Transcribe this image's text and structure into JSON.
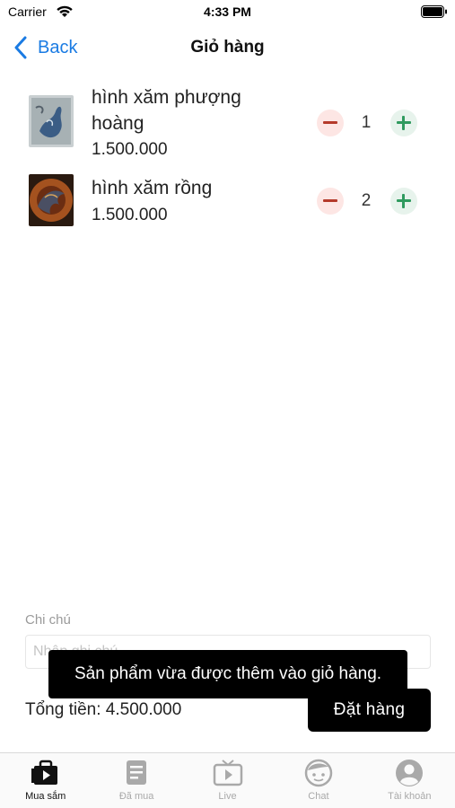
{
  "status_bar": {
    "carrier": "Carrier",
    "time": "4:33 PM"
  },
  "nav": {
    "back_label": "Back",
    "title": "Giỏ hàng"
  },
  "cart": {
    "items": [
      {
        "name": "hình xăm phượng hoàng",
        "price": "1.500.000",
        "quantity": "1"
      },
      {
        "name": "hình xăm rồng",
        "price": "1.500.000",
        "quantity": "2"
      }
    ]
  },
  "note": {
    "label": "Chi chú",
    "placeholder": "Nhập ghi chú",
    "value": ""
  },
  "summary": {
    "total_label": "Tổng tiền: 4.500.000",
    "order_button": "Đặt hàng"
  },
  "toast": {
    "message": "Sản phẩm vừa được thêm vào giỏ hàng."
  },
  "tabs": [
    {
      "label": "Mua sắm",
      "icon": "play-bag-icon",
      "active": true
    },
    {
      "label": "Đã mua",
      "icon": "document-icon",
      "active": false
    },
    {
      "label": "Live",
      "icon": "tv-icon",
      "active": false
    },
    {
      "label": "Chat",
      "icon": "face-icon",
      "active": false
    },
    {
      "label": "Tài khoản",
      "icon": "user-icon",
      "active": false
    }
  ],
  "colors": {
    "accent_blue": "#1a7be3",
    "minus_red": "#b53a2b",
    "plus_green": "#2f9a5e",
    "button_black": "#000000",
    "tab_inactive": "#a9a9a9"
  }
}
